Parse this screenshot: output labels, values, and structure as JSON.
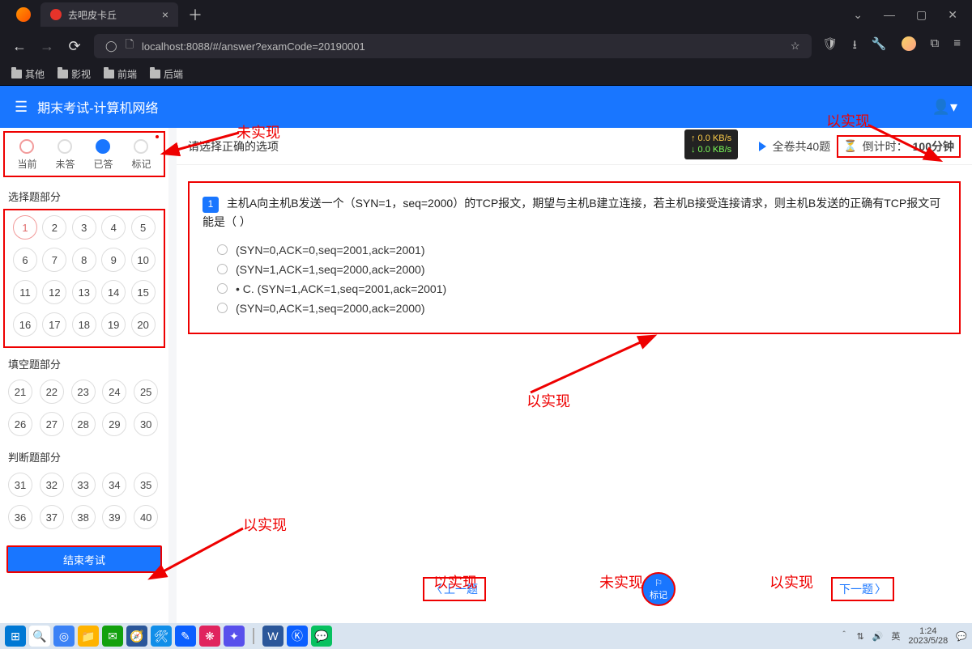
{
  "browser": {
    "tab_title": "去吧皮卡丘",
    "url": "localhost:8088/#/answer?examCode=20190001",
    "bookmarks": [
      "其他",
      "影视",
      "前端",
      "后端"
    ]
  },
  "net_overlay": {
    "up": "↑ 0.0 KB/s",
    "down": "↓ 0.0 KB/s"
  },
  "header": {
    "title": "期末考试-计算机网络"
  },
  "legend": {
    "current": "当前",
    "unanswered": "未答",
    "answered": "已答",
    "marked": "标记"
  },
  "sections": {
    "choice_title": "选择题部分",
    "fill_title": "填空题部分",
    "judge_title": "判断题部分",
    "choice_nums": [
      "1",
      "2",
      "3",
      "4",
      "5",
      "6",
      "7",
      "8",
      "9",
      "10",
      "11",
      "12",
      "13",
      "14",
      "15",
      "16",
      "17",
      "18",
      "19",
      "20"
    ],
    "fill_nums": [
      "21",
      "22",
      "23",
      "24",
      "25",
      "26",
      "27",
      "28",
      "29",
      "30"
    ],
    "judge_nums": [
      "31",
      "32",
      "33",
      "34",
      "35",
      "36",
      "37",
      "38",
      "39",
      "40"
    ]
  },
  "end_btn": "结束考试",
  "topline": {
    "prompt": "请选择正确的选项",
    "total": "全卷共40题",
    "timer_label": "倒计时：",
    "timer_value": "100分钟"
  },
  "question": {
    "number": "1",
    "text": "主机A向主机B发送一个（SYN=1，seq=2000）的TCP报文，期望与主机B建立连接，若主机B接受连接请求，则主机B发送的正确有TCP报文可能是（ ）",
    "options": [
      "(SYN=0,ACK=0,seq=2001,ack=2001)",
      "(SYN=1,ACK=1,seq=2000,ack=2000)",
      "• C.  (SYN=1,ACK=1,seq=2001,ack=2001)",
      "(SYN=0,ACK=1,seq=2000,ack=2000)"
    ]
  },
  "nav": {
    "prev": "上一题",
    "flag": "标记",
    "next": "下一题"
  },
  "annotations": {
    "a1": "未实现",
    "a2": "以实现",
    "a3": "以实现",
    "a4": "以实现",
    "a5": "未实现",
    "a6": "以实现",
    "a7": "以实现"
  },
  "taskbar": {
    "time": "1:24",
    "date": "2023/5/28",
    "ime": "英"
  }
}
